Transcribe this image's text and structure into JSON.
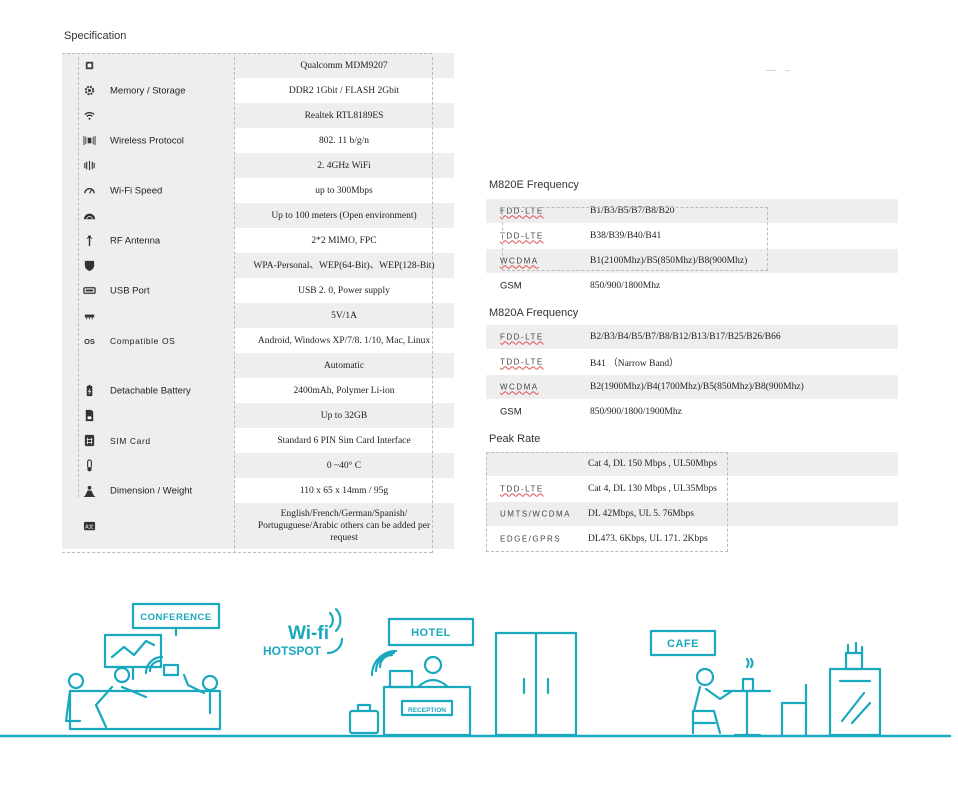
{
  "spec_title": "Specification",
  "spec_rows": [
    {
      "icon": "chip-icon",
      "label": "",
      "value": "Qualcomm MDM9207"
    },
    {
      "icon": "gear-icon",
      "label": "Memory / Storage",
      "value": "DDR2 1Gbit / FLASH 2Gbit"
    },
    {
      "icon": "wifi-icon",
      "label": "",
      "value": "Realtek RTL8189ES"
    },
    {
      "icon": "signal-broadcast-icon",
      "label": "Wireless  Protocol",
      "value": "802. 11 b/g/n"
    },
    {
      "icon": "radio-waves-icon",
      "label": "",
      "value": "2. 4GHz WiFi"
    },
    {
      "icon": "speedometer-icon",
      "label": "Wi-Fi Speed",
      "value": "up to 300Mbps"
    },
    {
      "icon": "range-arc-icon",
      "label": "",
      "value": "Up to 100 meters (Open environment)"
    },
    {
      "icon": "antenna-icon",
      "label": "RF Antenna",
      "value": "2*2 MIMO, FPC"
    },
    {
      "icon": "shield-icon",
      "label": "",
      "value": "WPA-Personal、WEP(64-Bit)、WEP(128-Bit)"
    },
    {
      "icon": "usb-port-icon",
      "label": "USB Port",
      "value": "USB 2. 0, Power supply"
    },
    {
      "icon": "power-plug-icon",
      "label": "",
      "value": "5V/1A"
    },
    {
      "icon": "os-icon",
      "label": "Compatible  OS",
      "value": "Android, Windows XP/7/8. 1/10, Mac, Linux"
    },
    {
      "icon": "moon-icon",
      "label": "",
      "value": "Automatic"
    },
    {
      "icon": "battery-icon",
      "label": "Detachable Battery",
      "value": "2400mAh, Polymer Li-ion"
    },
    {
      "icon": "sd-card-icon",
      "label": "",
      "value": "Up to 32GB"
    },
    {
      "icon": "sim-card-icon",
      "label": "SIM Card",
      "value": "Standard 6 PIN Sim Card Interface"
    },
    {
      "icon": "thermometer-icon",
      "label": "",
      "value": "0 ~40° C"
    },
    {
      "icon": "dimension-weight-icon",
      "label": "Dimension / Weight",
      "value": "110 x 65 x 14mm / 95g"
    },
    {
      "icon": "language-icon",
      "label": "",
      "value": "English/French/German/Spanish/ Portuguguese/Arabic others can be added per request"
    }
  ],
  "m820e": {
    "title": "M820E Frequency",
    "rows": [
      {
        "label": "FDD-LTE",
        "value": "B1/B3/B5/B7/B8/B20"
      },
      {
        "label": "TDD-LTE",
        "value": "B38/B39/B40/B41"
      },
      {
        "label": "WCDMA",
        "value": "B1(2100Mhz)/B5(850Mhz)/B8(900Mhz)"
      },
      {
        "label": "GSM",
        "value": "850/900/1800Mhz"
      }
    ]
  },
  "m820a": {
    "title": "M820A Frequency",
    "rows": [
      {
        "label": "FDD-LTE",
        "value": "B2/B3/B4/B5/B7/B8/B12/B13/B17/B25/B26/B66"
      },
      {
        "label": "TDD-LTE",
        "value": "B41 （Narrow Band）"
      },
      {
        "label": "WCDMA",
        "value": "B2(1900Mhz)/B4(1700Mhz)/B5(850Mhz)/B8(900Mhz)"
      },
      {
        "label": "GSM",
        "value": "850/900/1800/1900Mhz"
      }
    ]
  },
  "peak": {
    "title": "Peak Rate",
    "rows": [
      {
        "label": "",
        "value": "Cat 4, DL 150 Mbps , UL50Mbps"
      },
      {
        "label": "TDD-LTE",
        "value": "Cat 4, DL 130 Mbps , UL35Mbps"
      },
      {
        "label": "UMTS/WCDMA",
        "value": "DL 42Mbps, UL 5. 76Mbps"
      },
      {
        "label": "EDGE/GPRS",
        "value": "DL473. 6Kbps, UL 171. 2Kbps"
      }
    ]
  },
  "illustration": {
    "conference": "CONFERENCE",
    "wifi_word": "Wi-fi",
    "hotspot": "HOTSPOT",
    "hotel": "HOTEL",
    "reception": "RECEPTION",
    "cafe": "CAFE",
    "teal": "#1aa8bf"
  }
}
